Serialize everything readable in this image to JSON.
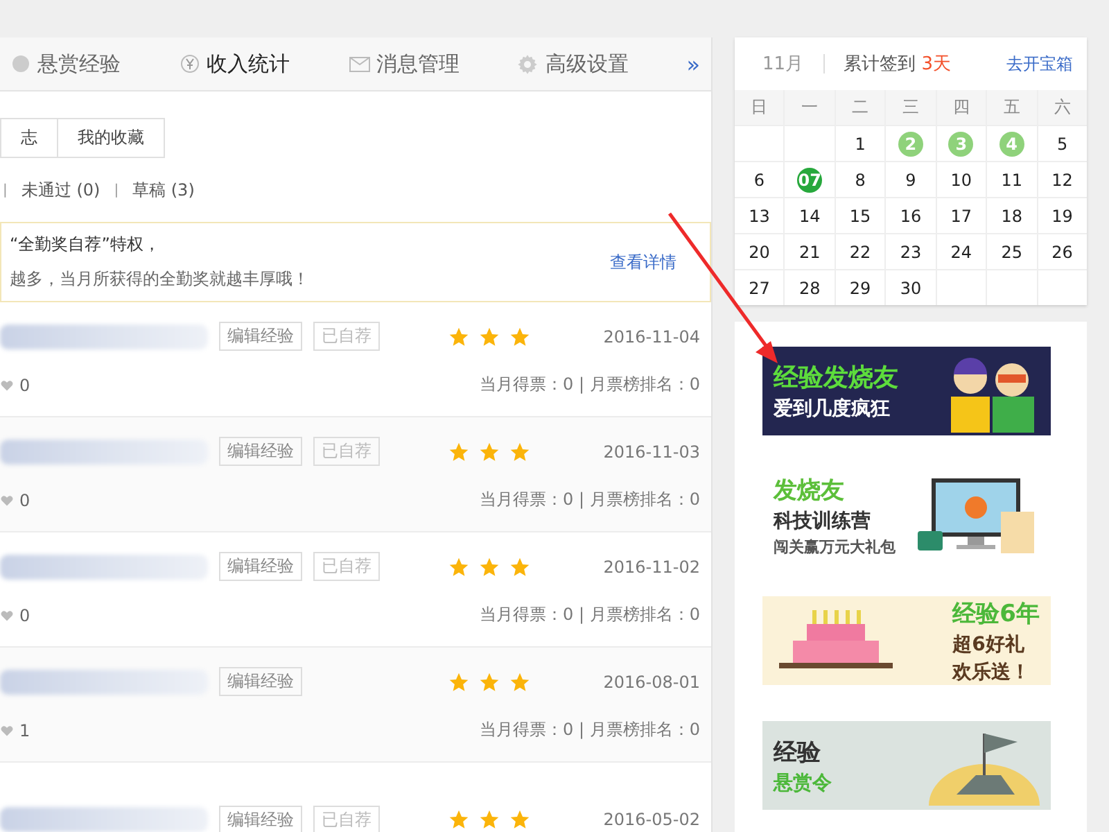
{
  "nav_tabs": [
    {
      "label": "悬赏经验",
      "kind": "circle",
      "selected": false
    },
    {
      "label": "收入统计",
      "kind": "yen",
      "selected": true
    },
    {
      "label": "消息管理",
      "kind": "mail",
      "selected": false
    },
    {
      "label": "高级设置",
      "kind": "gear",
      "selected": false
    }
  ],
  "nav_more": "»",
  "sub_tabs": [
    "志",
    "我的收藏"
  ],
  "filter_separator": "|",
  "filters": [
    "未通过 (0)",
    "草稿 (3)"
  ],
  "notice": {
    "line_1": "“全勤奖自荐”特权，",
    "line_2": "越多，当月所获得的全勤奖就越丰厚哦！",
    "link": "查看详情"
  },
  "rows": [
    {
      "edit": "编辑经验",
      "recommended": "已自荐",
      "stars": 3,
      "date": "2016-11-04",
      "likes": "0",
      "votes": "当月得票：0 | 月票榜排名：0"
    },
    {
      "edit": "编辑经验",
      "recommended": "已自荐",
      "stars": 3,
      "date": "2016-11-03",
      "likes": "0",
      "votes": "当月得票：0 | 月票榜排名：0"
    },
    {
      "edit": "编辑经验",
      "recommended": "已自荐",
      "stars": 3,
      "date": "2016-11-02",
      "likes": "0",
      "votes": "当月得票：0 | 月票榜排名：0"
    },
    {
      "edit": "编辑经验",
      "stars": 3,
      "date": "2016-08-01",
      "likes": "1",
      "votes": "当月得票：0 | 月票榜排名：0"
    },
    {
      "edit": "编辑经验",
      "recommended": "已自荐",
      "stars": 3,
      "date": "2016-05-02"
    }
  ],
  "calendar": {
    "month": "11月",
    "signed_label": "累计签到",
    "signed_count": "3天",
    "chest_link": "去开宝箱",
    "weekdays": [
      "日",
      "一",
      "二",
      "三",
      "四",
      "五",
      "六"
    ],
    "weeks": [
      [
        {
          "kind": "blank"
        },
        {
          "kind": "blank"
        },
        {
          "kind": "day",
          "day": "1",
          "signed": false,
          "today": false
        },
        {
          "kind": "day",
          "day": "2",
          "signed": true,
          "today": false
        },
        {
          "kind": "day",
          "day": "3",
          "signed": true,
          "today": false
        },
        {
          "kind": "day",
          "day": "4",
          "signed": true,
          "today": false
        },
        {
          "kind": "day",
          "day": "5",
          "signed": false,
          "today": false
        }
      ],
      [
        {
          "kind": "day",
          "day": "6",
          "signed": false,
          "today": false
        },
        {
          "kind": "day",
          "day": "07",
          "signed": false,
          "today": true
        },
        {
          "kind": "day",
          "day": "8",
          "signed": false,
          "today": false
        },
        {
          "kind": "day",
          "day": "9",
          "signed": false,
          "today": false
        },
        {
          "kind": "day",
          "day": "10",
          "signed": false,
          "today": false
        },
        {
          "kind": "day",
          "day": "11",
          "signed": false,
          "today": false
        },
        {
          "kind": "day",
          "day": "12",
          "signed": false,
          "today": false
        }
      ],
      [
        {
          "kind": "day",
          "day": "13",
          "signed": false,
          "today": false
        },
        {
          "kind": "day",
          "day": "14",
          "signed": false,
          "today": false
        },
        {
          "kind": "day",
          "day": "15",
          "signed": false,
          "today": false
        },
        {
          "kind": "day",
          "day": "16",
          "signed": false,
          "today": false
        },
        {
          "kind": "day",
          "day": "17",
          "signed": false,
          "today": false
        },
        {
          "kind": "day",
          "day": "18",
          "signed": false,
          "today": false
        },
        {
          "kind": "day",
          "day": "19",
          "signed": false,
          "today": false
        }
      ],
      [
        {
          "kind": "day",
          "day": "20",
          "signed": false,
          "today": false
        },
        {
          "kind": "day",
          "day": "21",
          "signed": false,
          "today": false
        },
        {
          "kind": "day",
          "day": "22",
          "signed": false,
          "today": false
        },
        {
          "kind": "day",
          "day": "23",
          "signed": false,
          "today": false
        },
        {
          "kind": "day",
          "day": "24",
          "signed": false,
          "today": false
        },
        {
          "kind": "day",
          "day": "25",
          "signed": false,
          "today": false
        },
        {
          "kind": "day",
          "day": "26",
          "signed": false,
          "today": false
        }
      ],
      [
        {
          "kind": "day",
          "day": "27",
          "signed": false,
          "today": false
        },
        {
          "kind": "day",
          "day": "28",
          "signed": false,
          "today": false
        },
        {
          "kind": "day",
          "day": "29",
          "signed": false,
          "today": false
        },
        {
          "kind": "day",
          "day": "30",
          "signed": false,
          "today": false
        },
        {
          "kind": "blank"
        },
        {
          "kind": "blank"
        },
        {
          "kind": "blank"
        }
      ]
    ]
  },
  "banners": [
    {
      "kind": "fans",
      "title": "经验发烧友",
      "subtitle": "爱到几度疯狂"
    },
    {
      "kind": "camp",
      "title": "发烧友",
      "subtitle": "科技训练营",
      "note": "闯关赢万元大礼包"
    },
    {
      "kind": "birthday",
      "title": "经验6年",
      "subtitle": "超6好礼",
      "note": "欢乐送！"
    },
    {
      "kind": "reward",
      "title": "经验",
      "subtitle": "悬赏令"
    }
  ]
}
